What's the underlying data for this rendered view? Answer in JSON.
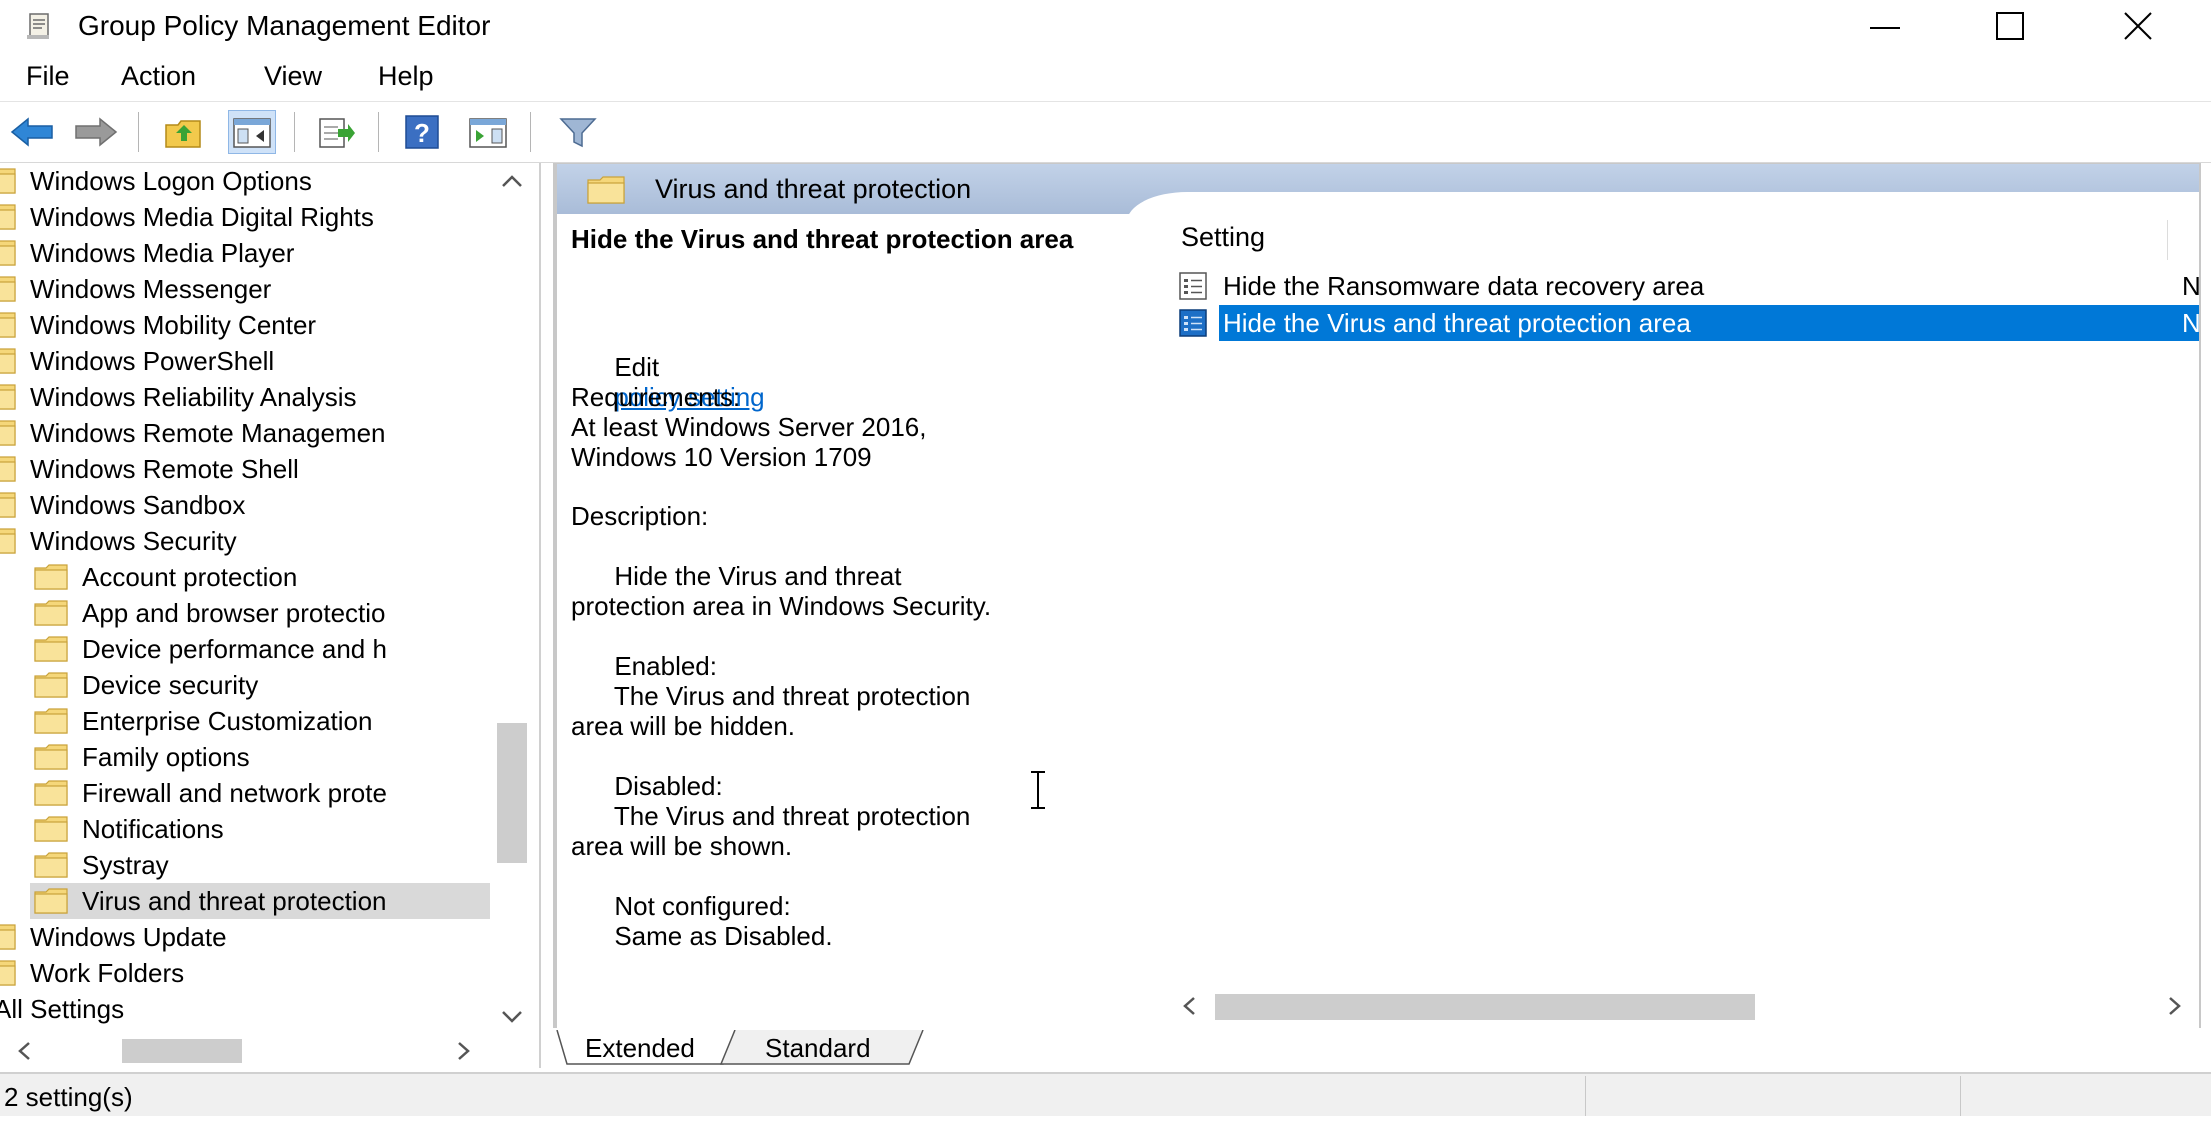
{
  "window": {
    "title": "Group Policy Management Editor",
    "icon": "policy-editor-icon"
  },
  "menu": [
    "File",
    "Action",
    "View",
    "Help"
  ],
  "toolbar": {
    "icons": [
      "back-arrow-icon",
      "forward-arrow-icon",
      "up-folder-icon",
      "show-hide-tree-icon",
      "export-list-icon",
      "help-icon",
      "console-view-icon",
      "filter-icon"
    ]
  },
  "tree": {
    "items": [
      {
        "label": "Windows Logon Options",
        "level": 0
      },
      {
        "label": "Windows Media Digital Rights",
        "level": 0
      },
      {
        "label": "Windows Media Player",
        "level": 0
      },
      {
        "label": "Windows Messenger",
        "level": 0
      },
      {
        "label": "Windows Mobility Center",
        "level": 0
      },
      {
        "label": "Windows PowerShell",
        "level": 0
      },
      {
        "label": "Windows Reliability Analysis",
        "level": 0
      },
      {
        "label": "Windows Remote Managemen",
        "level": 0
      },
      {
        "label": "Windows Remote Shell",
        "level": 0
      },
      {
        "label": "Windows Sandbox",
        "level": 0
      },
      {
        "label": "Windows Security",
        "level": 0
      },
      {
        "label": "Account protection",
        "level": 1
      },
      {
        "label": "App and browser protectio",
        "level": 1
      },
      {
        "label": "Device performance and h",
        "level": 1
      },
      {
        "label": "Device security",
        "level": 1
      },
      {
        "label": "Enterprise Customization",
        "level": 1
      },
      {
        "label": "Family options",
        "level": 1
      },
      {
        "label": "Firewall and network prote",
        "level": 1
      },
      {
        "label": "Notifications",
        "level": 1
      },
      {
        "label": "Systray",
        "level": 1
      },
      {
        "label": "Virus and threat protection",
        "level": 1,
        "selected": true
      },
      {
        "label": "Windows Update",
        "level": 0
      },
      {
        "label": "Work Folders",
        "level": 0
      },
      {
        "label": "All Settings",
        "level": -1
      }
    ]
  },
  "content": {
    "header_title": "Virus and threat protection",
    "policy_title": "Hide the Virus and threat protection area",
    "edit_prefix": "Edit",
    "edit_link": "policy setting",
    "requirements_label": "Requirements:",
    "requirements_value": "At least Windows Server 2016,\nWindows 10 Version 1709",
    "description_label": "Description:",
    "description_body": "      Hide the Virus and threat\nprotection area in Windows Security.\n\n      Enabled:\n      The Virus and threat protection\narea will be hidden.\n\n      Disabled:\n      The Virus and threat protection\narea will be shown.\n\n      Not configured:\n      Same as Disabled.",
    "column_setting": "Setting",
    "settings": [
      {
        "name": "Hide the Ransomware data recovery area",
        "state": "Nc",
        "selected": false
      },
      {
        "name": "Hide the Virus and threat protection area",
        "state": "Nc",
        "selected": true
      }
    ]
  },
  "tabs": [
    "Extended",
    "Standard"
  ],
  "status": {
    "text": "2 setting(s)"
  },
  "colors": {
    "selection": "#0078d7",
    "link": "#0066cc",
    "folder": "#f5d77a"
  }
}
